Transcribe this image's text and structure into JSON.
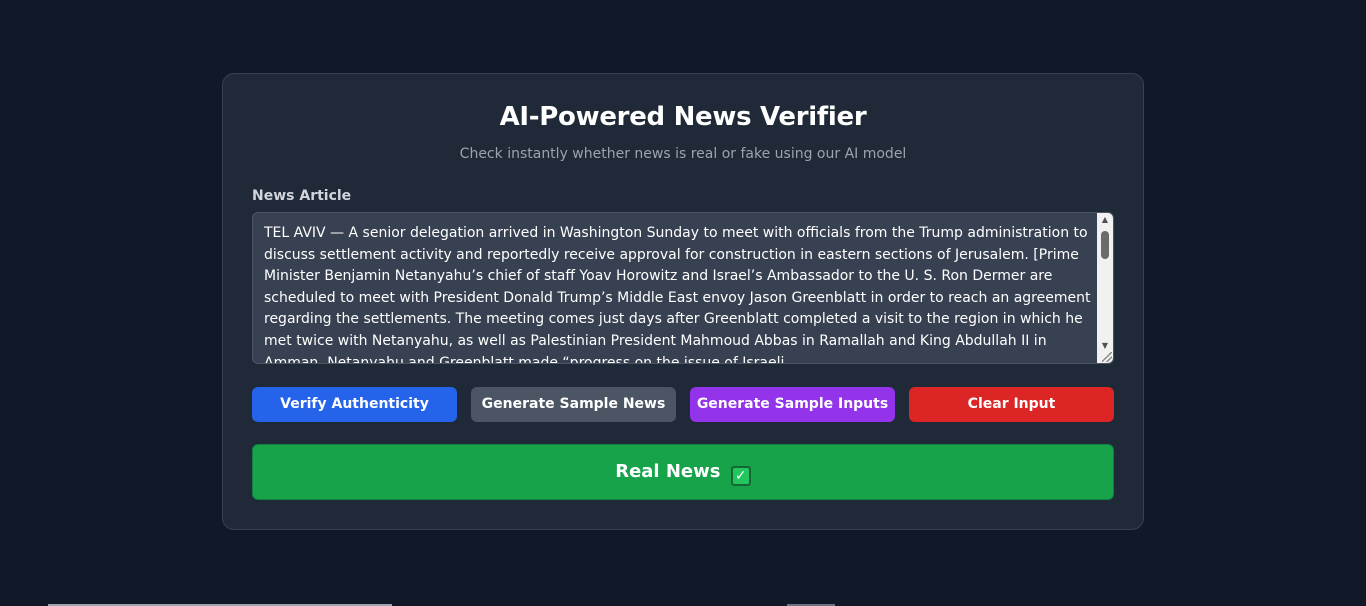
{
  "header": {
    "title": "AI-Powered News Verifier",
    "subtitle": "Check instantly whether news is real or fake using our AI model"
  },
  "input": {
    "label": "News Article",
    "value": "TEL AVIV  —   A senior delegation arrived in Washington Sunday to meet with officials from the Trump administration to discuss settlement activity and reportedly receive approval for construction in eastern sections of Jerusalem.  [Prime Minister Benjamin Netanyahu’s chief of staff Yoav Horowitz and Israel’s Ambassador to the U. S. Ron Dermer are scheduled to meet with President Donald Trump’s Middle East envoy Jason Greenblatt in order to reach an agreement regarding the settlements.  The meeting comes just days after Greenblatt completed a visit to the region in which he met twice with Netanyahu, as well as Palestinian President Mahmoud Abbas in Ramallah and King Abdullah II in Amman. Netanyahu and Greenblatt made “progress on the issue of Israeli"
  },
  "buttons": {
    "verify": "Verify Authenticity",
    "sample_news": "Generate Sample News",
    "sample_inputs": "Generate Sample Inputs",
    "clear": "Clear Input"
  },
  "result": {
    "text": "Real News",
    "icon": "check-mark-icon",
    "color": "#16a34a"
  },
  "colors": {
    "background": "#111827",
    "card": "#1f2937",
    "verify": "#2563eb",
    "sample_news": "#4b5563",
    "sample_inputs": "#9333ea",
    "clear": "#dc2626"
  }
}
